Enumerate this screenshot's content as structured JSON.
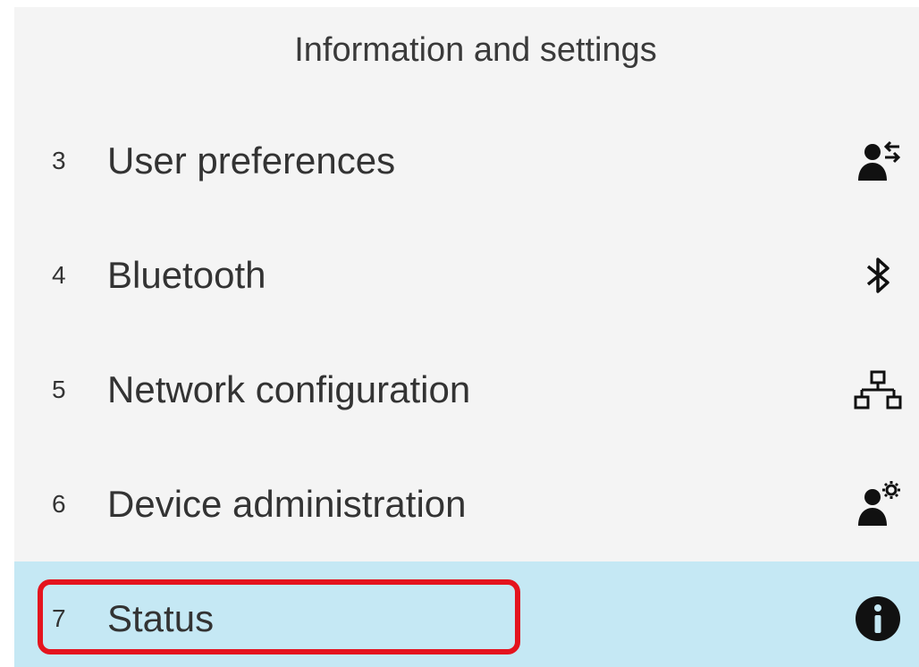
{
  "header": {
    "title": "Information and settings"
  },
  "menu": {
    "items": [
      {
        "number": "3",
        "label": "User preferences",
        "icon": "user-preferences-icon",
        "selected": false
      },
      {
        "number": "4",
        "label": "Bluetooth",
        "icon": "bluetooth-icon",
        "selected": false
      },
      {
        "number": "5",
        "label": "Network configuration",
        "icon": "network-icon",
        "selected": false
      },
      {
        "number": "6",
        "label": "Device administration",
        "icon": "device-admin-icon",
        "selected": false
      },
      {
        "number": "7",
        "label": "Status",
        "icon": "info-icon",
        "selected": true
      }
    ]
  },
  "colors": {
    "background": "#f4f4f4",
    "selected_row": "#c5e8f4",
    "highlight_outline": "#e4141e",
    "text": "#333333"
  }
}
